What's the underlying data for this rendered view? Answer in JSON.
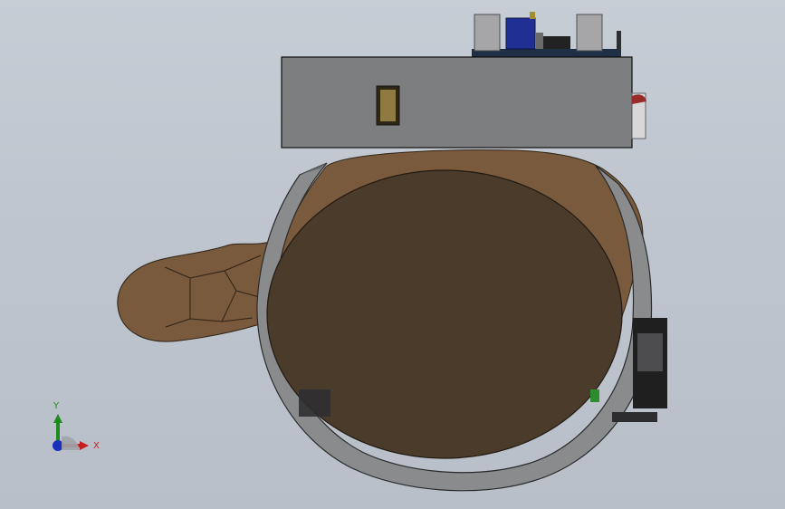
{
  "viewport": {
    "background_top": "#c7cdd5",
    "background_bottom": "#b9bfc8"
  },
  "triad": {
    "x_label": "X",
    "y_label": "Y",
    "x_color": "#c41e1e",
    "y_color": "#1e8b1e",
    "z_color": "#1b2fbf"
  },
  "model": {
    "box_color": "#7d7e80",
    "log_end_color": "#4a3b2b",
    "log_bark_color": "#7a5a3c",
    "ring_color": "#6b6c6e"
  }
}
